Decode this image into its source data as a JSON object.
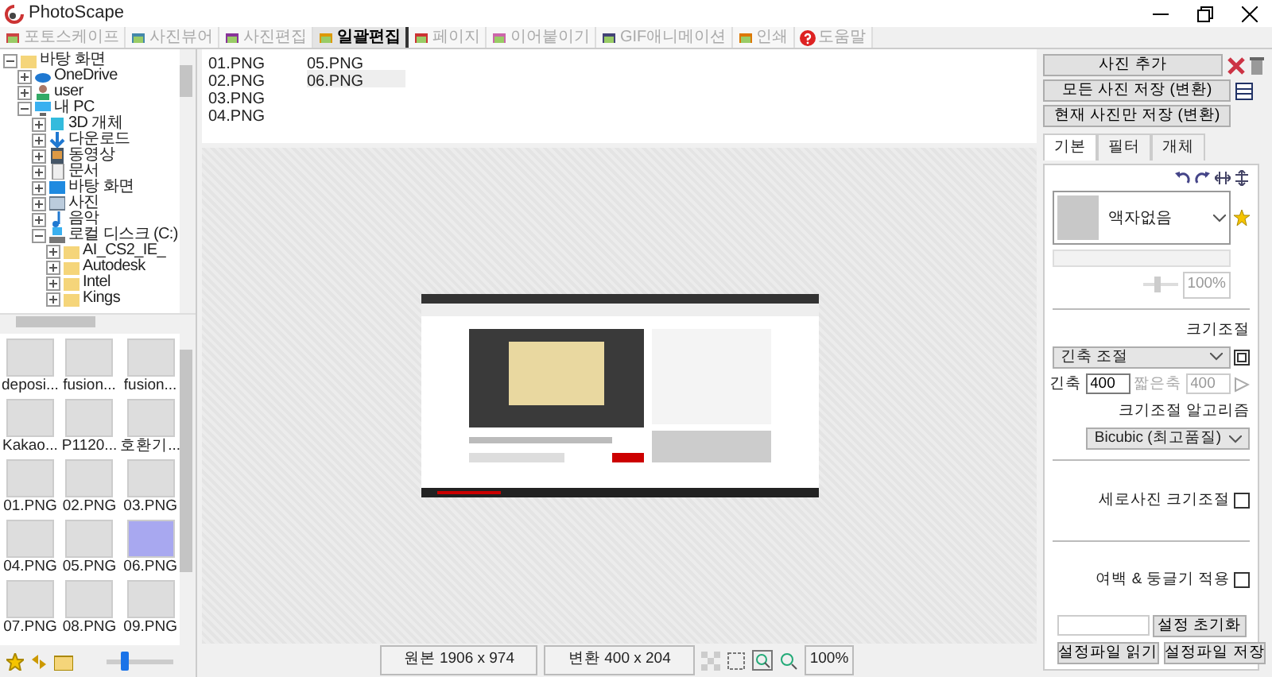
{
  "window": {
    "title": "PhotoScape"
  },
  "tabs": [
    {
      "label": "포토스케이프",
      "selected": false
    },
    {
      "label": "사진뷰어",
      "selected": false
    },
    {
      "label": "사진편집",
      "selected": false
    },
    {
      "label": "일괄편집",
      "selected": true
    },
    {
      "label": "페이지",
      "selected": false
    },
    {
      "label": "이어붙이기",
      "selected": false
    },
    {
      "label": "GIF애니메이션",
      "selected": false
    },
    {
      "label": "인쇄",
      "selected": false
    },
    {
      "label": "도움말",
      "selected": false
    }
  ],
  "tree": [
    {
      "label": "바탕 화면",
      "kind": "folder",
      "expanded": true,
      "children": [
        {
          "label": "OneDrive",
          "kind": "cloud",
          "expanded": false
        },
        {
          "label": "user",
          "kind": "user",
          "expanded": false
        },
        {
          "label": "내 PC",
          "kind": "pc",
          "expanded": true,
          "children": [
            {
              "label": "3D 개체",
              "kind": "cube",
              "expanded": false
            },
            {
              "label": "다운로드",
              "kind": "download",
              "expanded": false
            },
            {
              "label": "동영상",
              "kind": "video",
              "expanded": false
            },
            {
              "label": "문서",
              "kind": "doc",
              "expanded": false
            },
            {
              "label": "바탕 화면",
              "kind": "desktop",
              "expanded": false
            },
            {
              "label": "사진",
              "kind": "picture",
              "expanded": false
            },
            {
              "label": "음악",
              "kind": "music",
              "expanded": false
            },
            {
              "label": "로컬 디스크 (C:)",
              "kind": "drive",
              "expanded": true,
              "children": [
                {
                  "label": "AI_CS2_IE_",
                  "kind": "folder",
                  "expanded": false
                },
                {
                  "label": "Autodesk",
                  "kind": "folder",
                  "expanded": false
                },
                {
                  "label": "Intel",
                  "kind": "folder",
                  "expanded": false
                },
                {
                  "label": "Kings",
                  "kind": "folder",
                  "expanded": false
                }
              ]
            }
          ]
        }
      ]
    }
  ],
  "thumbnails": [
    {
      "label": "deposi...",
      "selected": false
    },
    {
      "label": "fusion...",
      "selected": false
    },
    {
      "label": "fusion...",
      "selected": false
    },
    {
      "label": "Kakao...",
      "selected": false
    },
    {
      "label": "P1120...",
      "selected": false
    },
    {
      "label": "호환기...",
      "selected": false
    },
    {
      "label": "01.PNG",
      "selected": false
    },
    {
      "label": "02.PNG",
      "selected": false
    },
    {
      "label": "03.PNG",
      "selected": false
    },
    {
      "label": "04.PNG",
      "selected": false
    },
    {
      "label": "05.PNG",
      "selected": false
    },
    {
      "label": "06.PNG",
      "selected": true
    },
    {
      "label": "07.PNG",
      "selected": false
    },
    {
      "label": "08.PNG",
      "selected": false
    },
    {
      "label": "09.PNG",
      "selected": false
    }
  ],
  "thumb_size": {
    "level": 0.25
  },
  "files": [
    {
      "name": "01.PNG",
      "selected": false
    },
    {
      "name": "02.PNG",
      "selected": false
    },
    {
      "name": "03.PNG",
      "selected": false
    },
    {
      "name": "04.PNG",
      "selected": false
    },
    {
      "name": "05.PNG",
      "selected": false
    },
    {
      "name": "06.PNG",
      "selected": true
    }
  ],
  "status_bar": {
    "original": "원본 1906 x 974",
    "converted": "변환 400 x 204",
    "zoom": "100%"
  },
  "actions": [
    "사진 추가",
    "모든 사진 저장 (변환)",
    "현재 사진만 저장 (변환)"
  ],
  "panel_tabs": [
    {
      "label": "기본",
      "selected": true
    },
    {
      "label": "필터",
      "selected": false
    },
    {
      "label": "개체",
      "selected": false
    }
  ],
  "frame": {
    "value": "액자없음",
    "opacity": {
      "level": 0.4,
      "disabled": true
    },
    "reading": "100%"
  },
  "resize": {
    "label": "크기조절",
    "mode": "긴축 조절",
    "long_label": "긴축",
    "long_value": "400",
    "short_label": "짧은축",
    "short_value": "400",
    "short_disabled": true,
    "algo_label": "크기조절 알고리즘",
    "algo": "Bicubic (최고품질)"
  },
  "options": [
    {
      "label": "세로사진 크기조절",
      "checked": false
    },
    {
      "label": "여백 & 둥글기 적용",
      "checked": false
    }
  ],
  "settings_buttons": [
    "설정 초기화",
    "설정파일 읽기",
    "설정파일 저장"
  ]
}
